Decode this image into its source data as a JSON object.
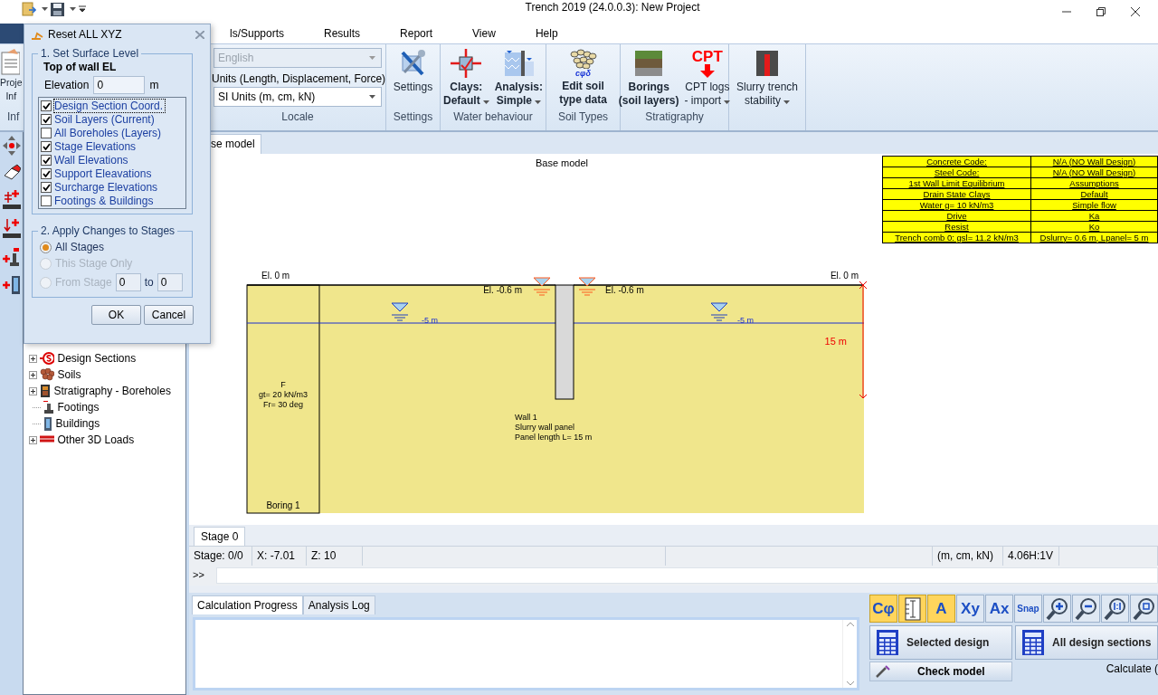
{
  "window": {
    "title": "Trench 2019 (24.0.0.3): New Project"
  },
  "menu": [
    {
      "label": "ls/Supports",
      "selected": false
    },
    {
      "label": "Results",
      "selected": false
    },
    {
      "label": "Report",
      "selected": false
    },
    {
      "label": "View",
      "selected": false
    },
    {
      "label": "Help",
      "selected": false
    }
  ],
  "ribbon": {
    "project_button": {
      "lines": [
        "Proje",
        "Inf"
      ]
    },
    "project_group_label": "Inf",
    "locale": {
      "language": {
        "value": "English",
        "disabled": true
      },
      "units_label": "Units (Length, Displacement, Force)",
      "units": {
        "value": "SI Units (m, cm, kN)",
        "disabled": false
      },
      "label": "Locale"
    },
    "groups": [
      {
        "label": "Settings",
        "buttons": [
          {
            "kind": "settings",
            "lines": [
              "Settings"
            ],
            "bold": false,
            "dropdown": false
          }
        ]
      },
      {
        "label": "Water behaviour",
        "buttons": [
          {
            "kind": "clays",
            "lines": [
              "Clays:",
              "Default"
            ],
            "bold": true,
            "dropdown": true
          },
          {
            "kind": "analysis",
            "lines": [
              "Analysis:",
              "Simple"
            ],
            "bold": true,
            "dropdown": true
          }
        ]
      },
      {
        "label": "Soil Types",
        "buttons": [
          {
            "kind": "soil",
            "icon_text": "cφδ",
            "lines": [
              "Edit soil",
              "type data"
            ],
            "bold": true,
            "dropdown": false
          }
        ]
      },
      {
        "label": "Stratigraphy",
        "buttons": [
          {
            "kind": "borings",
            "lines": [
              "Borings",
              "(soil layers)"
            ],
            "bold": true,
            "dropdown": false
          },
          {
            "kind": "cpt",
            "icon_text": "CPT",
            "lines": [
              "CPT logs",
              "- import"
            ],
            "bold": false,
            "dropdown": true
          }
        ]
      },
      {
        "buttons": [
          {
            "kind": "slurry",
            "lines": [
              "Slurry trench",
              "stability"
            ],
            "bold": false,
            "dropdown": true
          }
        ]
      }
    ]
  },
  "dialog": {
    "title": "Reset ALL XYZ",
    "surface": {
      "legend": "1. Set Surface Level",
      "heading": "Top of wall EL",
      "elevation_label": "Elevation",
      "elevation_value": "0",
      "unit": "m",
      "options": [
        {
          "label": "Design Section Coord.",
          "checked": true,
          "focused": true
        },
        {
          "label": "Soil Layers (Current)",
          "checked": true,
          "focused": false
        },
        {
          "label": "All Boreholes (Layers)",
          "checked": false,
          "focused": false
        },
        {
          "label": "Stage Elevations",
          "checked": true,
          "focused": false
        },
        {
          "label": "Wall Elevations",
          "checked": true,
          "focused": false
        },
        {
          "label": "Support Eleavations",
          "checked": true,
          "focused": false
        },
        {
          "label": "Surcharge Elevations",
          "checked": true,
          "focused": false
        },
        {
          "label": "Footings & Buildings",
          "checked": false,
          "focused": false
        }
      ]
    },
    "stages": {
      "legend": "2. Apply Changes to Stages",
      "options": [
        {
          "label": "All Stages",
          "selected": true,
          "disabled": false
        },
        {
          "label": "This Stage Only",
          "selected": false,
          "disabled": true
        },
        {
          "label": "From Stage",
          "selected": false,
          "disabled": true,
          "kind": "range"
        }
      ],
      "from_value": "0",
      "to_label": "to",
      "to_value": "0"
    },
    "buttons": [
      "OK",
      "Cancel"
    ]
  },
  "tree": [
    {
      "label": "Design Sections",
      "kind": "group"
    },
    {
      "label": "Soils",
      "kind": "group"
    },
    {
      "label": "Stratigraphy - Boreholes",
      "kind": "group"
    },
    {
      "label": "Footings",
      "kind": "leaf"
    },
    {
      "label": "Buildings",
      "kind": "leaf"
    },
    {
      "label": "Other 3D Loads",
      "kind": "group"
    }
  ],
  "document_tabs": [
    {
      "label": "se model",
      "selected": true
    }
  ],
  "drawing": {
    "title": "Base model",
    "info_table": [
      [
        "Concrete Code:",
        "N/A (NO Wall Design)"
      ],
      [
        "Steel Code:",
        "N/A (NO Wall Design)"
      ],
      [
        "1st Wall Limit Equilibrium",
        "Assumptions"
      ],
      [
        "Drain State Clays",
        "Default"
      ],
      [
        "Water g= 10 kN/m3",
        "Simple flow"
      ],
      [
        "Drive",
        "Ka"
      ],
      [
        "Resist",
        "Ko"
      ],
      [
        "Trench comb 0: gsl= 11.2 kN/m3",
        "Dslurry= 0.6 m, Lpanel= 5 m"
      ]
    ],
    "ground": {
      "left": "El. 0 m",
      "right": "El. 0 m"
    },
    "excavation": {
      "left": "El. -0.6 m",
      "right": "El. -0.6 m"
    },
    "water": {
      "left": "-5 m",
      "right": "-5 m"
    },
    "depth": "15 m",
    "soil": [
      "F",
      "gt= 20 kN/m3",
      "Fr= 30 deg"
    ],
    "boring": "Boring 1",
    "wall": [
      "Wall 1",
      "Slurry wall panel",
      "Panel length L= 15 m"
    ]
  },
  "stage_tabs": [
    {
      "label": "Stage 0",
      "selected": true
    }
  ],
  "status_bar": {
    "stage": "Stage: 0/0",
    "x": "X: -7.01",
    "z": "Z: 10",
    "units": "(m, cm, kN)",
    "scale": "4.06H:1V"
  },
  "command": {
    "prompt": ">>"
  },
  "bottom_tabs": [
    {
      "label": "Calculation Progress",
      "selected": true
    },
    {
      "label": "Analysis Log",
      "selected": false
    }
  ],
  "tools": [
    {
      "kind": "text",
      "label": "Cφ",
      "on": true
    },
    {
      "kind": "ruler",
      "on": true
    },
    {
      "kind": "text",
      "label": "A",
      "on": true
    },
    {
      "kind": "text",
      "label": "Xy",
      "on": false
    },
    {
      "kind": "text",
      "label": "Ax",
      "on": false
    },
    {
      "kind": "small",
      "label": "Snap",
      "on": false
    },
    {
      "kind": "zoom-in",
      "on": false
    },
    {
      "kind": "zoom-out",
      "on": false
    },
    {
      "kind": "zoom-fit",
      "on": false
    },
    {
      "kind": "zoom-window",
      "on": false
    }
  ],
  "calc_buttons": [
    {
      "label": "Selected design"
    },
    {
      "label": "All design sections"
    }
  ],
  "check_button": {
    "label": "Check model"
  },
  "calculate_label": "Calculate ("
}
